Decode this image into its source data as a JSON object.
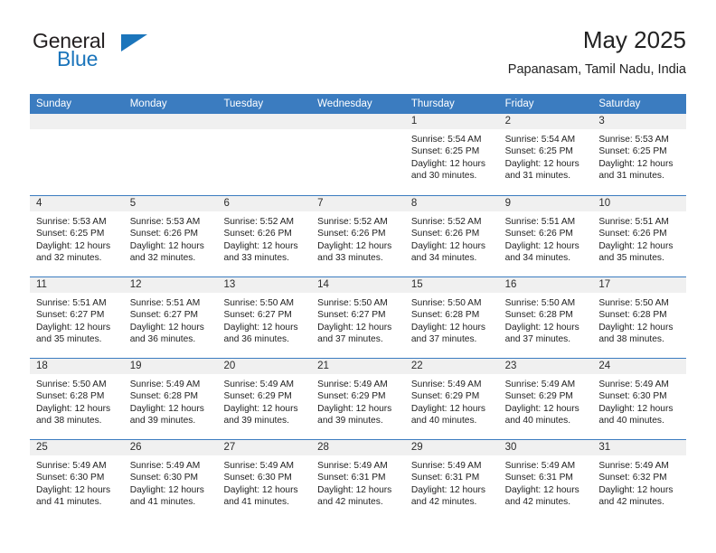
{
  "brand": {
    "name_top": "General",
    "name_bottom": "Blue",
    "accent_color": "#1b75bb",
    "triangle_icon": "triangle-icon"
  },
  "header": {
    "title": "May 2025",
    "subtitle": "Papanasam, Tamil Nadu, India"
  },
  "calendar": {
    "header_bg": "#3b7cc0",
    "day_band_bg": "#f0f0f0",
    "weekdays": [
      "Sunday",
      "Monday",
      "Tuesday",
      "Wednesday",
      "Thursday",
      "Friday",
      "Saturday"
    ],
    "weeks": [
      [
        {
          "day": "",
          "empty": true
        },
        {
          "day": "",
          "empty": true
        },
        {
          "day": "",
          "empty": true
        },
        {
          "day": "",
          "empty": true
        },
        {
          "day": "1",
          "sunrise": "Sunrise: 5:54 AM",
          "sunset": "Sunset: 6:25 PM",
          "daylight_1": "Daylight: 12 hours",
          "daylight_2": "and 30 minutes."
        },
        {
          "day": "2",
          "sunrise": "Sunrise: 5:54 AM",
          "sunset": "Sunset: 6:25 PM",
          "daylight_1": "Daylight: 12 hours",
          "daylight_2": "and 31 minutes."
        },
        {
          "day": "3",
          "sunrise": "Sunrise: 5:53 AM",
          "sunset": "Sunset: 6:25 PM",
          "daylight_1": "Daylight: 12 hours",
          "daylight_2": "and 31 minutes."
        }
      ],
      [
        {
          "day": "4",
          "sunrise": "Sunrise: 5:53 AM",
          "sunset": "Sunset: 6:25 PM",
          "daylight_1": "Daylight: 12 hours",
          "daylight_2": "and 32 minutes."
        },
        {
          "day": "5",
          "sunrise": "Sunrise: 5:53 AM",
          "sunset": "Sunset: 6:26 PM",
          "daylight_1": "Daylight: 12 hours",
          "daylight_2": "and 32 minutes."
        },
        {
          "day": "6",
          "sunrise": "Sunrise: 5:52 AM",
          "sunset": "Sunset: 6:26 PM",
          "daylight_1": "Daylight: 12 hours",
          "daylight_2": "and 33 minutes."
        },
        {
          "day": "7",
          "sunrise": "Sunrise: 5:52 AM",
          "sunset": "Sunset: 6:26 PM",
          "daylight_1": "Daylight: 12 hours",
          "daylight_2": "and 33 minutes."
        },
        {
          "day": "8",
          "sunrise": "Sunrise: 5:52 AM",
          "sunset": "Sunset: 6:26 PM",
          "daylight_1": "Daylight: 12 hours",
          "daylight_2": "and 34 minutes."
        },
        {
          "day": "9",
          "sunrise": "Sunrise: 5:51 AM",
          "sunset": "Sunset: 6:26 PM",
          "daylight_1": "Daylight: 12 hours",
          "daylight_2": "and 34 minutes."
        },
        {
          "day": "10",
          "sunrise": "Sunrise: 5:51 AM",
          "sunset": "Sunset: 6:26 PM",
          "daylight_1": "Daylight: 12 hours",
          "daylight_2": "and 35 minutes."
        }
      ],
      [
        {
          "day": "11",
          "sunrise": "Sunrise: 5:51 AM",
          "sunset": "Sunset: 6:27 PM",
          "daylight_1": "Daylight: 12 hours",
          "daylight_2": "and 35 minutes."
        },
        {
          "day": "12",
          "sunrise": "Sunrise: 5:51 AM",
          "sunset": "Sunset: 6:27 PM",
          "daylight_1": "Daylight: 12 hours",
          "daylight_2": "and 36 minutes."
        },
        {
          "day": "13",
          "sunrise": "Sunrise: 5:50 AM",
          "sunset": "Sunset: 6:27 PM",
          "daylight_1": "Daylight: 12 hours",
          "daylight_2": "and 36 minutes."
        },
        {
          "day": "14",
          "sunrise": "Sunrise: 5:50 AM",
          "sunset": "Sunset: 6:27 PM",
          "daylight_1": "Daylight: 12 hours",
          "daylight_2": "and 37 minutes."
        },
        {
          "day": "15",
          "sunrise": "Sunrise: 5:50 AM",
          "sunset": "Sunset: 6:28 PM",
          "daylight_1": "Daylight: 12 hours",
          "daylight_2": "and 37 minutes."
        },
        {
          "day": "16",
          "sunrise": "Sunrise: 5:50 AM",
          "sunset": "Sunset: 6:28 PM",
          "daylight_1": "Daylight: 12 hours",
          "daylight_2": "and 37 minutes."
        },
        {
          "day": "17",
          "sunrise": "Sunrise: 5:50 AM",
          "sunset": "Sunset: 6:28 PM",
          "daylight_1": "Daylight: 12 hours",
          "daylight_2": "and 38 minutes."
        }
      ],
      [
        {
          "day": "18",
          "sunrise": "Sunrise: 5:50 AM",
          "sunset": "Sunset: 6:28 PM",
          "daylight_1": "Daylight: 12 hours",
          "daylight_2": "and 38 minutes."
        },
        {
          "day": "19",
          "sunrise": "Sunrise: 5:49 AM",
          "sunset": "Sunset: 6:28 PM",
          "daylight_1": "Daylight: 12 hours",
          "daylight_2": "and 39 minutes."
        },
        {
          "day": "20",
          "sunrise": "Sunrise: 5:49 AM",
          "sunset": "Sunset: 6:29 PM",
          "daylight_1": "Daylight: 12 hours",
          "daylight_2": "and 39 minutes."
        },
        {
          "day": "21",
          "sunrise": "Sunrise: 5:49 AM",
          "sunset": "Sunset: 6:29 PM",
          "daylight_1": "Daylight: 12 hours",
          "daylight_2": "and 39 minutes."
        },
        {
          "day": "22",
          "sunrise": "Sunrise: 5:49 AM",
          "sunset": "Sunset: 6:29 PM",
          "daylight_1": "Daylight: 12 hours",
          "daylight_2": "and 40 minutes."
        },
        {
          "day": "23",
          "sunrise": "Sunrise: 5:49 AM",
          "sunset": "Sunset: 6:29 PM",
          "daylight_1": "Daylight: 12 hours",
          "daylight_2": "and 40 minutes."
        },
        {
          "day": "24",
          "sunrise": "Sunrise: 5:49 AM",
          "sunset": "Sunset: 6:30 PM",
          "daylight_1": "Daylight: 12 hours",
          "daylight_2": "and 40 minutes."
        }
      ],
      [
        {
          "day": "25",
          "sunrise": "Sunrise: 5:49 AM",
          "sunset": "Sunset: 6:30 PM",
          "daylight_1": "Daylight: 12 hours",
          "daylight_2": "and 41 minutes."
        },
        {
          "day": "26",
          "sunrise": "Sunrise: 5:49 AM",
          "sunset": "Sunset: 6:30 PM",
          "daylight_1": "Daylight: 12 hours",
          "daylight_2": "and 41 minutes."
        },
        {
          "day": "27",
          "sunrise": "Sunrise: 5:49 AM",
          "sunset": "Sunset: 6:30 PM",
          "daylight_1": "Daylight: 12 hours",
          "daylight_2": "and 41 minutes."
        },
        {
          "day": "28",
          "sunrise": "Sunrise: 5:49 AM",
          "sunset": "Sunset: 6:31 PM",
          "daylight_1": "Daylight: 12 hours",
          "daylight_2": "and 42 minutes."
        },
        {
          "day": "29",
          "sunrise": "Sunrise: 5:49 AM",
          "sunset": "Sunset: 6:31 PM",
          "daylight_1": "Daylight: 12 hours",
          "daylight_2": "and 42 minutes."
        },
        {
          "day": "30",
          "sunrise": "Sunrise: 5:49 AM",
          "sunset": "Sunset: 6:31 PM",
          "daylight_1": "Daylight: 12 hours",
          "daylight_2": "and 42 minutes."
        },
        {
          "day": "31",
          "sunrise": "Sunrise: 5:49 AM",
          "sunset": "Sunset: 6:32 PM",
          "daylight_1": "Daylight: 12 hours",
          "daylight_2": "and 42 minutes."
        }
      ]
    ]
  }
}
